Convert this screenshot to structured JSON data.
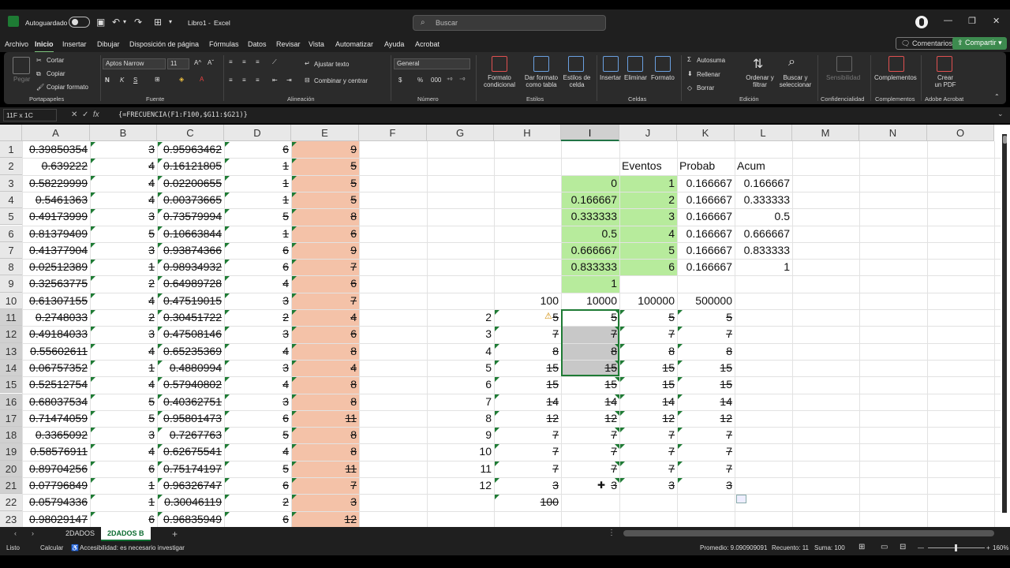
{
  "titlebar": {
    "autosave": "Autoguardado",
    "file": "Libro1",
    "app": "Excel",
    "search_placeholder": "Buscar"
  },
  "menu": [
    "Archivo",
    "Inicio",
    "Insertar",
    "Dibujar",
    "Disposición de página",
    "Fórmulas",
    "Datos",
    "Revisar",
    "Vista",
    "Automatizar",
    "Ayuda",
    "Acrobat"
  ],
  "actions": {
    "comments": "Comentarios",
    "share": "Compartir"
  },
  "ribbon": {
    "paste": "Pegar",
    "cut": "Cortar",
    "copy": "Copiar",
    "copy_format": "Copiar formato",
    "clipboard": "Portapapeles",
    "font_name": "Aptos Narrow",
    "font_size": "11",
    "font": "Fuente",
    "wrap": "Ajustar texto",
    "merge": "Combinar y centrar",
    "alignment": "Alineación",
    "number_format": "General",
    "number": "Número",
    "cond_format": "Formato condicional",
    "table_format": "Dar formato como tabla",
    "cell_styles": "Estilos de celda",
    "styles": "Estilos",
    "insert": "Insertar",
    "delete": "Eliminar",
    "format": "Formato",
    "cells": "Celdas",
    "autosum": "Autosuma",
    "fill": "Rellenar",
    "clear": "Borrar",
    "sort": "Ordenar y filtrar",
    "find": "Buscar y seleccionar",
    "editing": "Edición",
    "sensitivity": "Sensibilidad",
    "confidentiality": "Confidencialidad",
    "addins": "Complementos",
    "addins_grp": "Complementos",
    "pdf": "Crear un PDF",
    "acrobat": "Adobe Acrobat"
  },
  "formula_bar": {
    "namebox": "11F x 1C",
    "formula": "{=FRECUENCIA(F1:F100,$G11:$G21)}"
  },
  "columns": [
    "A",
    "B",
    "C",
    "D",
    "E",
    "F",
    "G",
    "H",
    "I",
    "J",
    "K",
    "L",
    "M",
    "N",
    "O"
  ],
  "rows": [
    "1",
    "2",
    "3",
    "4",
    "5",
    "6",
    "7",
    "8",
    "9",
    "10",
    "11",
    "12",
    "13",
    "14",
    "15",
    "16",
    "17",
    "18",
    "19",
    "20",
    "21",
    "22",
    "23"
  ],
  "colA": [
    "0.39850354",
    "0.639222",
    "0.58229999",
    "0.5461363",
    "0.49173999",
    "0.81379409",
    "0.41377904",
    "0.02512389",
    "0.32563775",
    "0.61307155",
    "0.2748033",
    "0.49184033",
    "0.55602611",
    "0.06757352",
    "0.52512754",
    "0.68037534",
    "0.71474059",
    "0.3365092",
    "0.58576911",
    "0.89704256",
    "0.07796849",
    "0.05794336",
    "0.98029147"
  ],
  "colB": [
    "3",
    "4",
    "4",
    "4",
    "3",
    "5",
    "3",
    "1",
    "2",
    "4",
    "2",
    "3",
    "4",
    "1",
    "4",
    "5",
    "5",
    "3",
    "4",
    "6",
    "1",
    "1",
    "6"
  ],
  "colC": [
    "0.95963462",
    "0.16121805",
    "0.02200655",
    "0.00373665",
    "0.73579994",
    "0.10663844",
    "0.93874366",
    "0.98934932",
    "0.64989728",
    "0.47519015",
    "0.30451722",
    "0.47508146",
    "0.65235369",
    "0.4880994",
    "0.57940802",
    "0.40362751",
    "0.95801473",
    "0.7267763",
    "0.62675541",
    "0.75174197",
    "0.96326747",
    "0.30046119",
    "0.96835949"
  ],
  "colD": [
    "6",
    "1",
    "1",
    "1",
    "5",
    "1",
    "6",
    "6",
    "4",
    "3",
    "2",
    "3",
    "4",
    "3",
    "4",
    "3",
    "6",
    "5",
    "4",
    "5",
    "6",
    "2",
    "6"
  ],
  "colE": [
    "9",
    "5",
    "5",
    "5",
    "8",
    "6",
    "9",
    "7",
    "6",
    "7",
    "4",
    "6",
    "8",
    "4",
    "8",
    "8",
    "11",
    "8",
    "8",
    "11",
    "7",
    "3",
    "12"
  ],
  "headers_row2": {
    "J": "Eventos",
    "K": "Probab",
    "L": "Acum"
  },
  "colI_top": [
    "0",
    "0.166667",
    "0.333333",
    "0.5",
    "0.666667",
    "0.833333",
    "1"
  ],
  "colJ_top": [
    "1",
    "2",
    "3",
    "4",
    "5",
    "6"
  ],
  "colK_top": [
    "0.166667",
    "0.166667",
    "0.166667",
    "0.166667",
    "0.166667",
    "0.166667"
  ],
  "colL_top": [
    "0.166667",
    "0.333333",
    "0.5",
    "0.666667",
    "0.833333",
    "1"
  ],
  "row10": {
    "H": "100",
    "I": "10000",
    "J": "100000",
    "K": "500000"
  },
  "colG": [
    "2",
    "3",
    "4",
    "5",
    "6",
    "7",
    "8",
    "9",
    "10",
    "11",
    "12"
  ],
  "colH": [
    "5",
    "7",
    "8",
    "15",
    "15",
    "14",
    "12",
    "7",
    "7",
    "7",
    "3",
    "100"
  ],
  "colI": [
    "5",
    "7",
    "8",
    "15",
    "15",
    "14",
    "12",
    "7",
    "7",
    "7",
    "3"
  ],
  "colJ": [
    "5",
    "7",
    "8",
    "15",
    "15",
    "14",
    "12",
    "7",
    "7",
    "7",
    "3"
  ],
  "colK": [
    "5",
    "7",
    "8",
    "15",
    "15",
    "14",
    "12",
    "7",
    "7",
    "7",
    "3"
  ],
  "sheets": [
    "2DADOS",
    "2DADOS B"
  ],
  "status": {
    "ready": "Listo",
    "calc": "Calcular",
    "access": "Accesibilidad: es necesario investigar",
    "avg": "Promedio: 9.090909091",
    "count": "Recuento: 11",
    "sum": "Suma: 100",
    "zoom": "160%"
  }
}
